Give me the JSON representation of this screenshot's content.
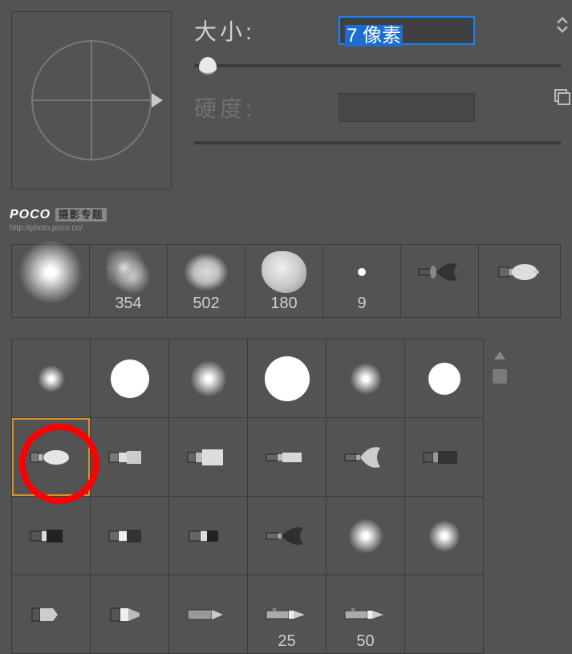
{
  "labels": {
    "size": "大小:",
    "hardness": "硬度:"
  },
  "size_value": "7 像素",
  "watermark": {
    "brand": "POCO",
    "tag": "摄影专题",
    "url": "http://photo.poco.cn/"
  },
  "presets": [
    {
      "label": "",
      "kind": "soft-large"
    },
    {
      "label": "354",
      "kind": "splatter"
    },
    {
      "label": "502",
      "kind": "chalk"
    },
    {
      "label": "180",
      "kind": "blob"
    },
    {
      "label": "9",
      "kind": "dot"
    },
    {
      "label": "",
      "kind": "fan-brush"
    },
    {
      "label": "",
      "kind": "bullet-brush"
    }
  ],
  "grid": [
    [
      {
        "kind": "soft",
        "size": 34
      },
      {
        "kind": "hard",
        "size": 48
      },
      {
        "kind": "soft",
        "size": 46
      },
      {
        "kind": "hard",
        "size": 56
      },
      {
        "kind": "soft",
        "size": 40
      },
      {
        "kind": "hard",
        "size": 40
      }
    ],
    [
      {
        "kind": "bullet",
        "selected": true
      },
      {
        "kind": "flat-stub"
      },
      {
        "kind": "flat-wide"
      },
      {
        "kind": "flat-thin"
      },
      {
        "kind": "fan"
      },
      {
        "kind": "flat-dark"
      }
    ],
    [
      {
        "kind": "flat-square"
      },
      {
        "kind": "flat-hl"
      },
      {
        "kind": "flat-short"
      },
      {
        "kind": "round-fan"
      },
      {
        "kind": "soft",
        "size": 44
      },
      {
        "kind": "soft",
        "size": 40
      }
    ],
    [
      {
        "kind": "marker"
      },
      {
        "kind": "marker2"
      },
      {
        "kind": "pencil-hex"
      },
      {
        "kind": "pencil",
        "num": "25"
      },
      {
        "kind": "pencil",
        "num": "50"
      },
      {
        "kind": "blank"
      }
    ]
  ]
}
